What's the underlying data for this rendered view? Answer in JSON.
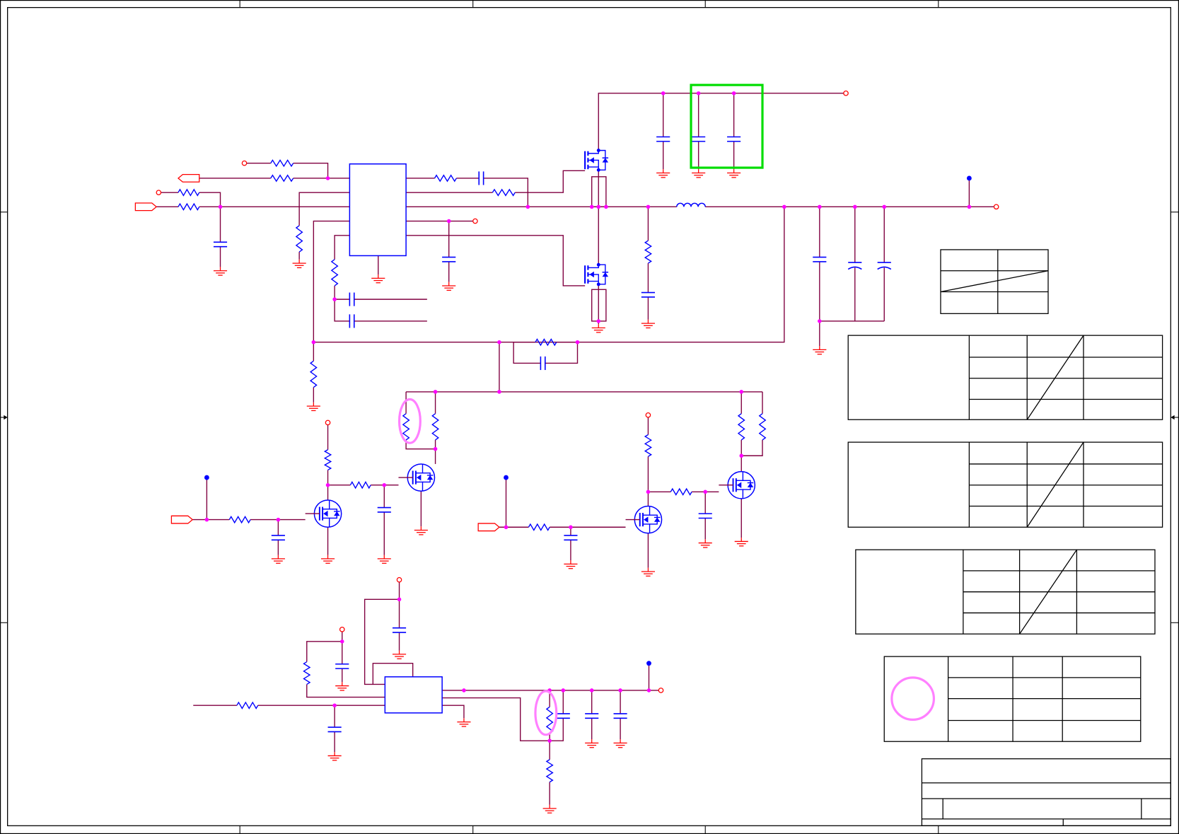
{
  "schematic": {
    "colors": {
      "background": "#ffffff",
      "wire": "#800040",
      "pin": "#ff0000",
      "component": "#0000ff",
      "junction": "#ff00ff",
      "ground": "#ff0000",
      "frame": "#000000",
      "highlight_box": "#00dd00",
      "highlight_ellipse": "#ff80ff"
    },
    "icons": [
      "resistor-icon",
      "capacitor-icon",
      "polarized-capacitor-icon",
      "inductor-icon",
      "mosfet-icon",
      "ground-icon",
      "port-arrow-icon",
      "open-terminal-icon",
      "junction-dot-icon"
    ]
  }
}
